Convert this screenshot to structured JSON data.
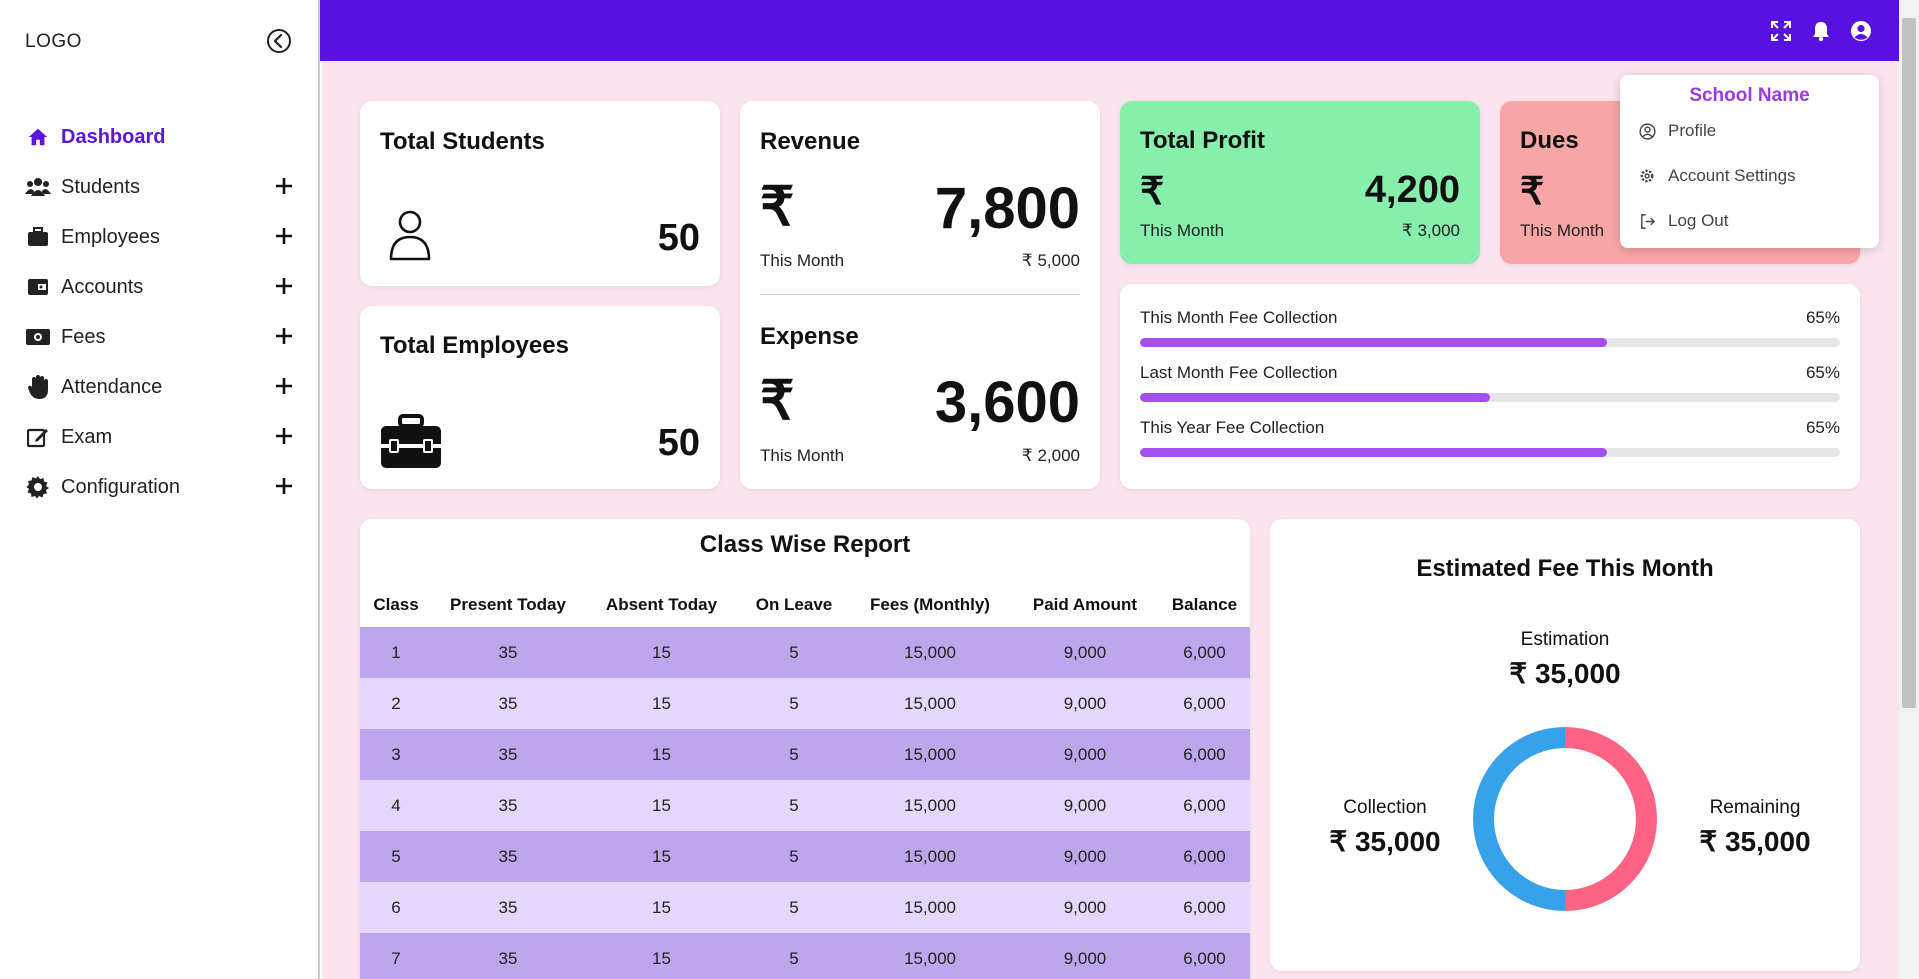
{
  "sidebar": {
    "logo": "LOGO",
    "items": [
      {
        "label": "Dashboard",
        "icon": "home-icon",
        "active": true
      },
      {
        "label": "Students",
        "icon": "users-icon"
      },
      {
        "label": "Employees",
        "icon": "briefcase-icon"
      },
      {
        "label": "Accounts",
        "icon": "wallet-icon"
      },
      {
        "label": "Fees",
        "icon": "money-icon"
      },
      {
        "label": "Attendance",
        "icon": "hand-icon"
      },
      {
        "label": "Exam",
        "icon": "edit-icon"
      },
      {
        "label": "Configuration",
        "icon": "gear-icon"
      }
    ]
  },
  "topbar": {
    "icons": [
      "fullscreen-icon",
      "bell-icon",
      "user-circle-icon"
    ]
  },
  "cards": {
    "total_students": {
      "title": "Total Students",
      "value": "50"
    },
    "total_employees": {
      "title": "Total Employees",
      "value": "50"
    },
    "revenue": {
      "title": "Revenue",
      "currency": "₹",
      "value": "7,800",
      "period": "This Month",
      "previous": "₹ 5,000"
    },
    "expense": {
      "title": "Expense",
      "currency": "₹",
      "value": "3,600",
      "period": "This Month",
      "previous": "₹ 2,000"
    },
    "total_profit": {
      "title": "Total Profit",
      "currency": "₹",
      "value": "4,200",
      "period": "This Month",
      "previous": "₹ 3,000"
    },
    "dues": {
      "title": "Dues",
      "currency": "₹",
      "period": "This Month"
    }
  },
  "fee_collection": [
    {
      "label": "This Month Fee Collection",
      "percent_label": "65%",
      "fill": 0.667
    },
    {
      "label": "Last Month Fee Collection",
      "percent_label": "65%",
      "fill": 0.5
    },
    {
      "label": "This Year Fee Collection",
      "percent_label": "65%",
      "fill": 0.667
    }
  ],
  "class_report": {
    "title": "Class Wise Report",
    "columns": [
      "Class",
      "Present Today",
      "Absent Today",
      "On Leave",
      "Fees (Monthly)",
      "Paid Amount",
      "Balance"
    ],
    "rows": [
      [
        "1",
        "35",
        "15",
        "5",
        "15,000",
        "9,000",
        "6,000"
      ],
      [
        "2",
        "35",
        "15",
        "5",
        "15,000",
        "9,000",
        "6,000"
      ],
      [
        "3",
        "35",
        "15",
        "5",
        "15,000",
        "9,000",
        "6,000"
      ],
      [
        "4",
        "35",
        "15",
        "5",
        "15,000",
        "9,000",
        "6,000"
      ],
      [
        "5",
        "35",
        "15",
        "5",
        "15,000",
        "9,000",
        "6,000"
      ],
      [
        "6",
        "35",
        "15",
        "5",
        "15,000",
        "9,000",
        "6,000"
      ],
      [
        "7",
        "35",
        "15",
        "5",
        "15,000",
        "9,000",
        "6,000"
      ]
    ]
  },
  "estimated_fee": {
    "title": "Estimated Fee This Month",
    "estimation_label": "Estimation",
    "estimation_value": "₹ 35,000",
    "collection_label": "Collection",
    "collection_value": "₹ 35,000",
    "remaining_label": "Remaining",
    "remaining_value": "₹ 35,000",
    "donut": [
      {
        "name": "Collection",
        "value": 50,
        "color": "#36a2eb"
      },
      {
        "name": "Remaining",
        "value": 50,
        "color": "#ff6384"
      }
    ]
  },
  "dropdown": {
    "title": "School Name",
    "items": [
      {
        "label": "Profile",
        "icon": "user-circle-icon"
      },
      {
        "label": "Account Settings",
        "icon": "settings-icon"
      },
      {
        "label": "Log Out",
        "icon": "logout-icon"
      }
    ]
  },
  "colors": {
    "brand": "#5712e0",
    "page_bg": "#fce4ef",
    "profit_card": "#86efac",
    "dues_card": "#f8a5a5",
    "progress": "#a34ff0",
    "dropdown_title": "#9b3be8"
  }
}
